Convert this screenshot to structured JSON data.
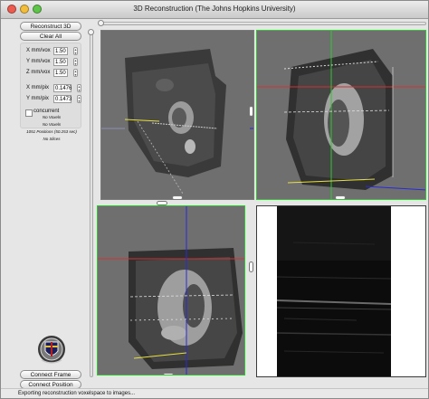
{
  "window": {
    "title": "3D Reconstruction (The Johns Hopkins University)"
  },
  "buttons": {
    "reconstruct": "Reconstruct 3D",
    "clear_all": "Clear All",
    "connect_frame": "Connect Frame",
    "connect_position": "Connect Position"
  },
  "params": [
    {
      "label": "X mm/vox",
      "value": "1.50"
    },
    {
      "label": "Y mm/vox",
      "value": "1.50"
    },
    {
      "label": "Z mm/vox",
      "value": "1.50"
    }
  ],
  "pixparams": [
    {
      "label": "X mm/pix",
      "value": "0.1476"
    },
    {
      "label": "Y mm/pix",
      "value": "0.1473"
    }
  ],
  "concurrent": {
    "label": "concurrent",
    "checked": false
  },
  "info": [
    "No Voxels",
    "No Voxels",
    "1051 Positions (50.253 sec)",
    "No Slices"
  ],
  "status": {
    "text": "Exporting reconstruction voxelspace to images..."
  },
  "icons": {
    "logo": "jhu-seal-icon"
  },
  "colors": {
    "crosshair_red": "#d83030",
    "crosshair_blue": "#2a2ad8",
    "crosshair_green": "#2ec82e",
    "probe_yellow": "#e8e040",
    "viewer_bg": "#6f6f6f"
  }
}
